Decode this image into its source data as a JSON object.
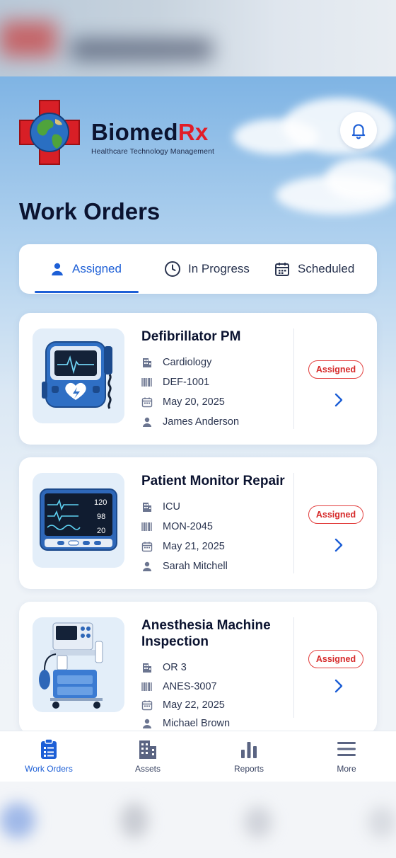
{
  "brand": {
    "name_main": "Biomed",
    "name_accent": "Rx",
    "tagline": "Healthcare Technology Management"
  },
  "page": {
    "title": "Work Orders"
  },
  "tabs": [
    {
      "label": "Assigned",
      "icon": "user-icon",
      "active": true
    },
    {
      "label": "In Progress",
      "icon": "clock-icon",
      "active": false
    },
    {
      "label": "Scheduled",
      "icon": "calendar-icon",
      "active": false
    }
  ],
  "work_orders": [
    {
      "title": "Defibrillator PM",
      "department": "Cardiology",
      "asset_id": "DEF-1001",
      "date": "May 20, 2025",
      "technician": "James Anderson",
      "status": "Assigned",
      "image": "defibrillator"
    },
    {
      "title": "Patient Monitor Repair",
      "department": "ICU",
      "asset_id": "MON-2045",
      "date": "May 21, 2025",
      "technician": "Sarah Mitchell",
      "status": "Assigned",
      "image": "patient-monitor",
      "monitor_values": [
        "120",
        "98",
        "20"
      ]
    },
    {
      "title": "Anesthesia Machine Inspection",
      "department": "OR 3",
      "asset_id": "ANES-3007",
      "date": "May 22, 2025",
      "technician": "Michael Brown",
      "status": "Assigned",
      "image": "anesthesia-machine"
    }
  ],
  "bottom_nav": [
    {
      "label": "Work Orders",
      "icon": "clipboard-icon",
      "active": true
    },
    {
      "label": "Assets",
      "icon": "building-icon",
      "active": false
    },
    {
      "label": "Reports",
      "icon": "bar-chart-icon",
      "active": false
    },
    {
      "label": "More",
      "icon": "menu-icon",
      "active": false
    }
  ],
  "colors": {
    "accent": "#1d5fd6",
    "brand_red": "#e11d27",
    "status_red": "#d62a2a",
    "text_dark": "#0b1330"
  }
}
